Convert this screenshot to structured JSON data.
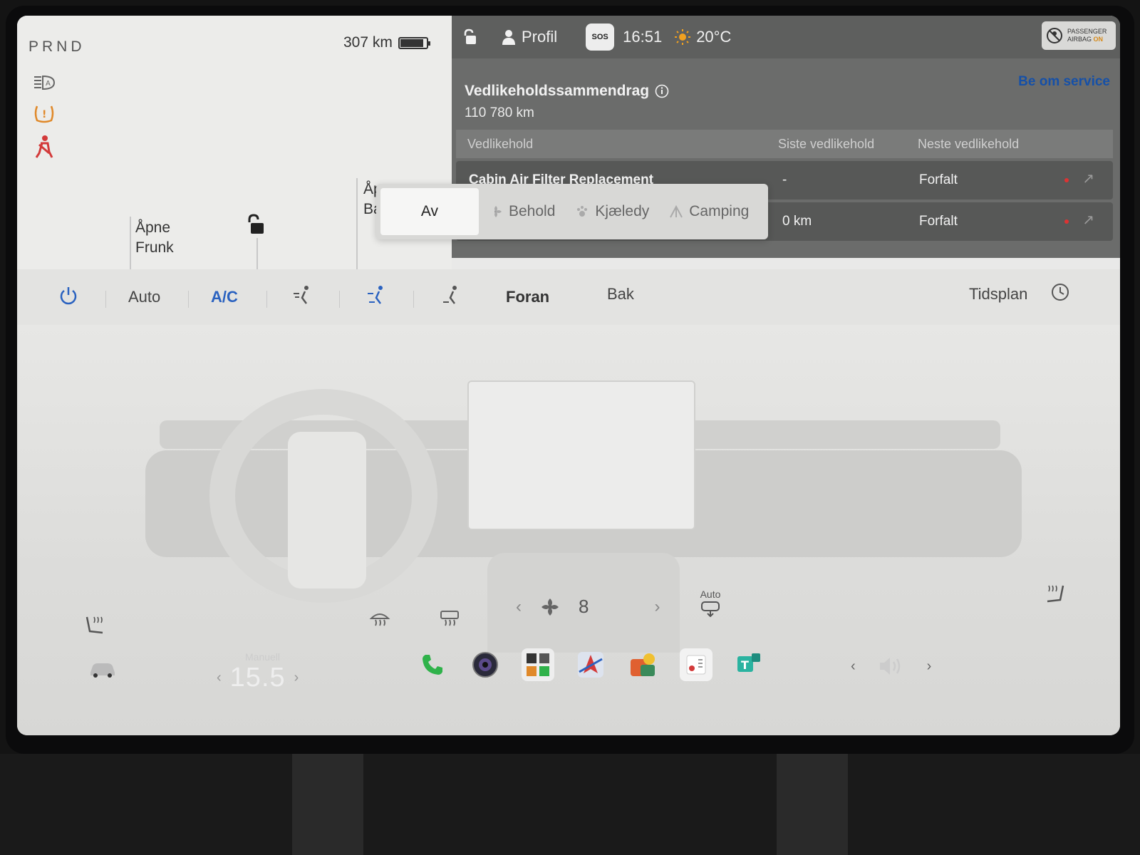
{
  "left": {
    "gear": "PRND",
    "range": "307 km",
    "battery_level": 0.85,
    "frunk_label": "Åpne\nFrunk",
    "trunk_label": "Åpne\nBa"
  },
  "status": {
    "profile": "Profil",
    "sos": "SOS",
    "time": "16:51",
    "temperature": "20°C",
    "airbag_line1": "PASSENGER",
    "airbag_line2": "AIRBAG",
    "airbag_state": "ON"
  },
  "maintenance": {
    "title": "Vedlikeholdssammendrag",
    "odometer": "110 780  km",
    "service_link": "Be om service",
    "headers": [
      "Vedlikehold",
      "Siste vedlikehold",
      "Neste vedlikehold"
    ],
    "rows": [
      {
        "name": "Cabin Air Filter Replacement",
        "last": "-",
        "next": "Forfalt"
      },
      {
        "name": "",
        "last": "0 km",
        "next": "Forfalt"
      }
    ]
  },
  "climate_mode_popup": {
    "options": [
      "Av",
      "Behold",
      "Kjæledy",
      "Camping"
    ],
    "selected": "Av"
  },
  "climate": {
    "auto": "Auto",
    "ac": "A/C",
    "front": "Foran",
    "rear": "Bak",
    "schedule": "Tidsplan",
    "fan_speed": "8",
    "recirc_label": "Auto"
  },
  "taskbar": {
    "temp_mode": "Manuell",
    "temp_value": "15.5",
    "apps": [
      "phone-icon",
      "camera-icon",
      "toybox-icon",
      "navigation-icon",
      "games-icon",
      "calendar-icon",
      "teams-icon"
    ]
  },
  "colors": {
    "accent_blue": "#2a62c0",
    "warning_orange": "#e0892a",
    "alert_red": "#d33a3a",
    "phone_green": "#2fb24a",
    "service_link": "#1550a8"
  }
}
